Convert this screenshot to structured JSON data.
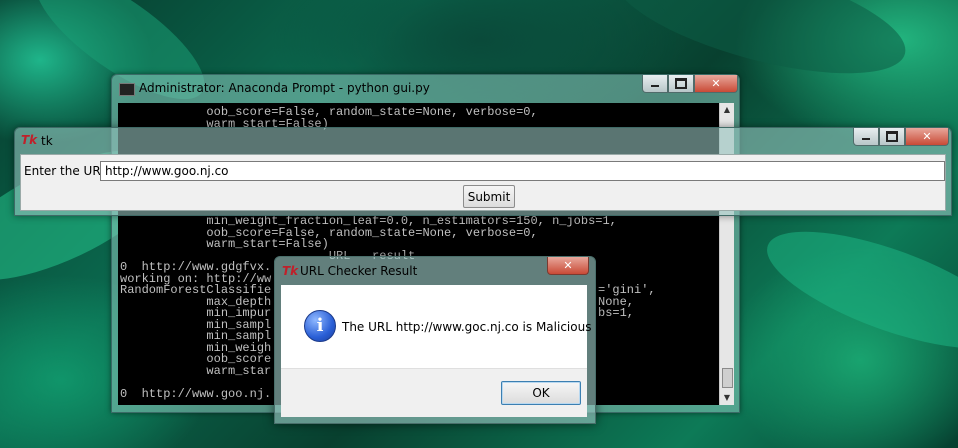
{
  "cmd_window": {
    "title": "Administrator: Anaconda Prompt - python  gui.py",
    "console_lines_top": [
      "            oob_score=False, random_state=None, verbose=0,",
      "            warm_start=False)"
    ],
    "console_lines_mid": [
      "            min_weight_fraction_leaf=0.0, n_estimators=150, n_jobs=1,",
      "            oob_score=False, random_state=None, verbose=0,",
      "            warm_start=False)",
      "                             URL   result",
      "0  http://www.gdgfvx.",
      "working on: http://ww",
      "RandomForestClassifie",
      "            max_depth",
      "            min_impur",
      "            min_sampl",
      "            min_sampl",
      "            min_weigh",
      "            oob_score",
      "            warm_star",
      "",
      "0  http://www.goo.nj."
    ],
    "console_right_fragments": [
      "='gini',",
      "None,",
      "bs=1,"
    ]
  },
  "tk_window": {
    "title": "tk",
    "url_label": "Enter the URL:",
    "url_value": "http://www.goo.nj.co",
    "submit_label": "Submit"
  },
  "message_box": {
    "title": "URL Checker Result",
    "message": "The URL http://www.goc.nj.co is Malicious",
    "ok_label": "OK"
  },
  "icons": {
    "tk_app_icon": "tk-feather-icon",
    "info_icon": "information-icon"
  },
  "colors": {
    "close_button": "#c94a36",
    "console_bg": "#000000",
    "console_text": "#c0c0c0",
    "info_icon_blue": "#2a5fd6"
  }
}
